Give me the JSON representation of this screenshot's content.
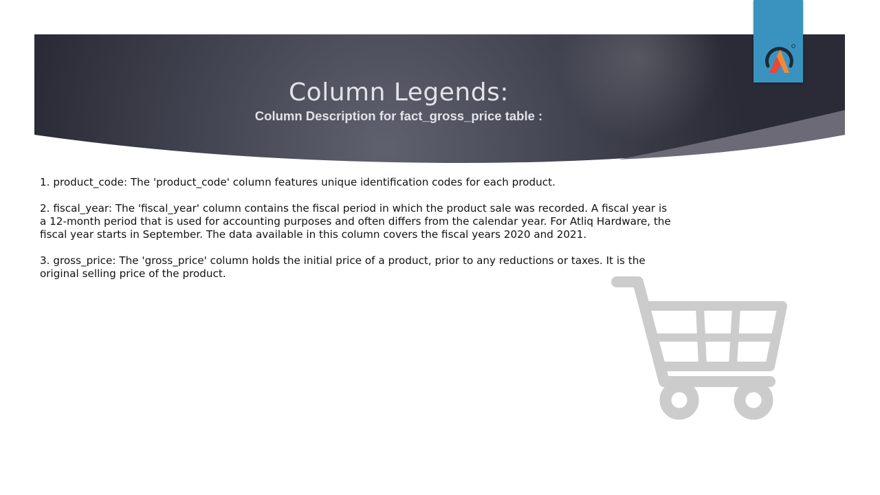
{
  "slide": {
    "title": "Column Legends:",
    "subtitle": "Column Description for fact_gross_price table :",
    "descriptions": [
      "1. product_code: The 'product_code' column features unique identification codes for each product.",
      "2. fiscal_year: The 'fiscal_year' column contains the fiscal period in which the product sale was recorded. A fiscal year is a 12-month period that is used for accounting purposes and often differs from the calendar year. For Atliq Hardware, the fiscal year starts in September. The data available in this column covers the fiscal years 2020 and 2021.",
      "3. gross_price: The 'gross_price' column holds the initial price of a product, prior to any reductions or taxes. It is the original selling price of the product."
    ]
  },
  "icons": {
    "logo": "atliq-logo-icon",
    "cart": "shopping-cart-icon"
  },
  "colors": {
    "banner_dark": "#2e2f3b",
    "banner_light": "#5d5f6e",
    "logo_tab": "#3a93bf",
    "cart": "#cccccc",
    "title_text": "#e2e3ea",
    "body_text": "#111111"
  }
}
